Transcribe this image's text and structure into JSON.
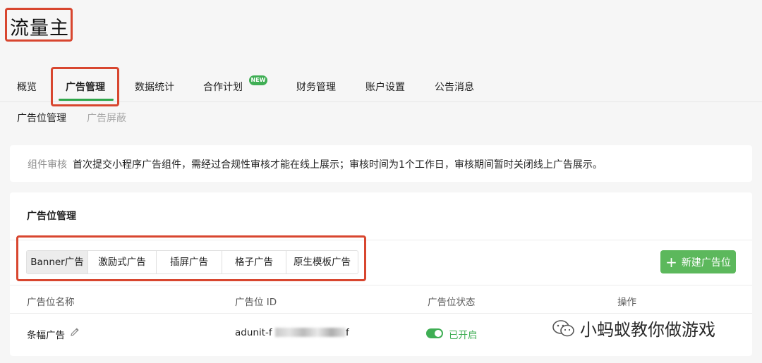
{
  "app": {
    "title": "流量主"
  },
  "nav": {
    "tabs": [
      {
        "label": "概览"
      },
      {
        "label": "广告管理"
      },
      {
        "label": "数据统计"
      },
      {
        "label": "合作计划"
      },
      {
        "label": "财务管理"
      },
      {
        "label": "账户设置"
      },
      {
        "label": "公告消息"
      }
    ],
    "new_badge": "NEW",
    "active_tab": "广告管理"
  },
  "subnav": {
    "items": [
      {
        "label": "广告位管理"
      },
      {
        "label": "广告屏蔽"
      }
    ]
  },
  "notice": {
    "label": "组件审核",
    "text": "首次提交小程序广告组件，需经过合规性审核才能在线上展示；审核时间为1个工作日，审核期间暂时关闭线上广告展示。"
  },
  "main": {
    "section_title": "广告位管理",
    "type_tabs": [
      {
        "label": "Banner广告"
      },
      {
        "label": "激励式广告"
      },
      {
        "label": "插屏广告"
      },
      {
        "label": "格子广告"
      },
      {
        "label": "原生模板广告"
      }
    ],
    "selected_type": "Banner广告",
    "new_button": "新建广告位",
    "table": {
      "columns": [
        "广告位名称",
        "广告位 ID",
        "广告位状态",
        "操作"
      ],
      "rows": [
        {
          "name": "条幅广告",
          "id_prefix": "adunit-f",
          "id_suffix": "f",
          "status": "已开启"
        }
      ]
    }
  },
  "watermark": {
    "text": "小蚂蚁教你做游戏"
  },
  "colors": {
    "accent_green": "#3fae54",
    "button_green": "#5cb85c",
    "highlight_red": "#d8462f"
  }
}
